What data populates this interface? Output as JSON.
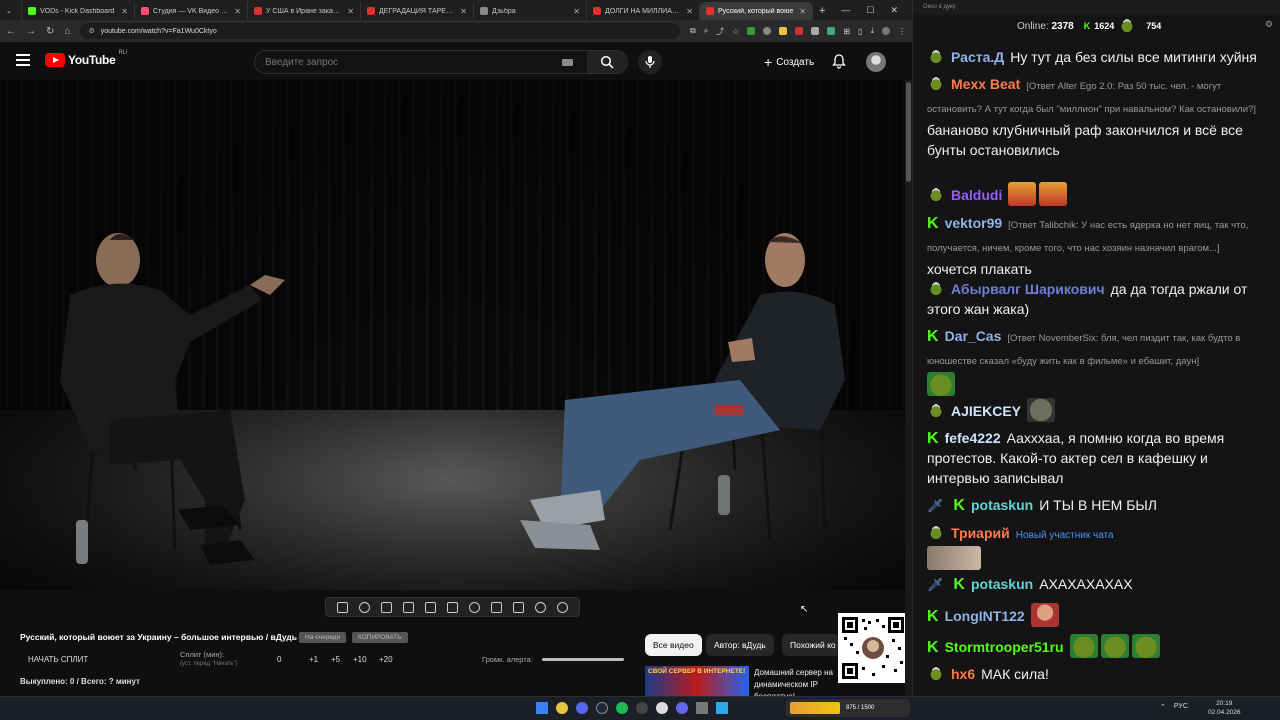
{
  "browser": {
    "tabs": [
      {
        "title": "VODs - Kick Dashboard",
        "color": "#53fc18",
        "active": false
      },
      {
        "title": "Студия — VK Видео Live",
        "color": "#ff4d6d",
        "active": false
      },
      {
        "title": "У США в Иране заканчиваю",
        "color": "#e03131",
        "active": false
      },
      {
        "title": "ДЕГРАДАЦИЯ ТАРЕЛОЧНИК",
        "color": "#e03131",
        "active": false
      },
      {
        "title": "Дзьбра",
        "color": "#888888",
        "active": false
      },
      {
        "title": "ДОЛГИ НА МИЛЛИАРДЫ",
        "color": "#e03131",
        "active": false
      },
      {
        "title": "Русский, который воюе",
        "color": "#e03131",
        "active": true
      }
    ],
    "new_tab": "+",
    "url": "youtube.com/watch?v=Fa1Wu0Cktyo"
  },
  "youtube": {
    "logo_text": "YouTube",
    "country": "RU",
    "search_placeholder": "Введите запрос",
    "create_label": "Создать"
  },
  "panel": {
    "video_title": "Русский, который воюет за Украину – большое интервью / вДудь",
    "pill_1": "На очереди",
    "pill_2": "КОПИРОВАТЬ",
    "start_split": "НАЧАТЬ СПЛИТ",
    "split_label": "Сплит (мин):",
    "split_hint": "(уст. перед \"Начать\")",
    "steps": [
      "0",
      "+1",
      "+5",
      "+10",
      "+20"
    ],
    "volume_label": "Громк. алерта:",
    "volume_level_fraction": 1.0,
    "bought": "Выкуплено: 0 / Всего: ? минут"
  },
  "chips": [
    "Все видео",
    "Автор: вДудь",
    "Похожий ко"
  ],
  "ad": {
    "thumb_text": "СВОЙ СЕРВЕР В ИНТЕРНЕТЕ!",
    "text": "Домашний сервер на динамическом IP бесплатно!..."
  },
  "chat": {
    "window_title": "Окно в дуку",
    "online_label": "Online:",
    "online_count": "2378",
    "stat_a": "1624",
    "stat_b": "754",
    "messages": [
      {
        "user": "Раста.Д",
        "color": "#8fb3e8",
        "badge": "pepe",
        "text": "Ну тут да без силы все митинги хуйня"
      },
      {
        "user": "Mexx Beat",
        "color": "#ff7a4d",
        "badge": "pepe",
        "reply": "[Ответ Alter Ego 2.0: Раз 50 тыс. чел. - могут остановить? А тут когда был \"миллион\" при навальном? Как остановили?]",
        "text": "бананово клубничный раф закончился и всё все бунты остановились"
      },
      {
        "user": "Baldudi",
        "color": "#9b5cff",
        "badge": "pepe",
        "text": ""
      },
      {
        "user": "vektor99",
        "color": "#8fb3e8",
        "badge": "kick",
        "reply": "[Ответ Talibchik: У нас есть ядерка но нет яиц, так что, получается, ничем, кроме того, что нас хозяин назначил врагом...]",
        "text": "хочется плакать"
      },
      {
        "user": "Абырвалг Шарикович",
        "color": "#6b7fd6",
        "badge": "pepe",
        "text": "да да тогда ржали от этого жан жака)"
      },
      {
        "user": "Dar_Cas",
        "color": "#8fb3e8",
        "badge": "kick",
        "reply": "[Ответ NovemberSix: бля, чел пиздит так, как будто в юношестве сказал «буду жить как в фильме» и ебашит, даун]",
        "text": ""
      },
      {
        "user": "AJIEKCEY",
        "color": "#cde3ff",
        "badge": "pepe",
        "text": ""
      },
      {
        "user": "fefe4222",
        "color": "#cde3ff",
        "badge": "kick",
        "text": "Аахххаа, я помню когда во время протестов. Какой-то актер сел в кафешку и интервью записывал"
      },
      {
        "user": "potaskun",
        "color": "#5fd6d6",
        "badge": "kick",
        "text": "И ТЫ В НЕМ БЫЛ"
      },
      {
        "user": "Триарий",
        "color": "#ff7a4d",
        "badge": "pepe",
        "note": "Новый участник чата",
        "text": ""
      },
      {
        "user": "potaskun",
        "color": "#5fd6d6",
        "badge": "kick",
        "text": "АХАХАХАХАХ"
      },
      {
        "user": "LongINT122",
        "color": "#8fb3e8",
        "badge": "kick",
        "text": ""
      },
      {
        "user": "Stormtrooper51ru",
        "color": "#53fc18",
        "badge": "kick",
        "text": ""
      },
      {
        "user": "hx6",
        "color": "#ff7a4d",
        "badge": "pepe",
        "text": "МАК сила!"
      }
    ]
  },
  "taskbar": {
    "lang": "РУС",
    "time": "20:19",
    "date": "02.04.2026",
    "widget_text": "875 / 1500"
  }
}
